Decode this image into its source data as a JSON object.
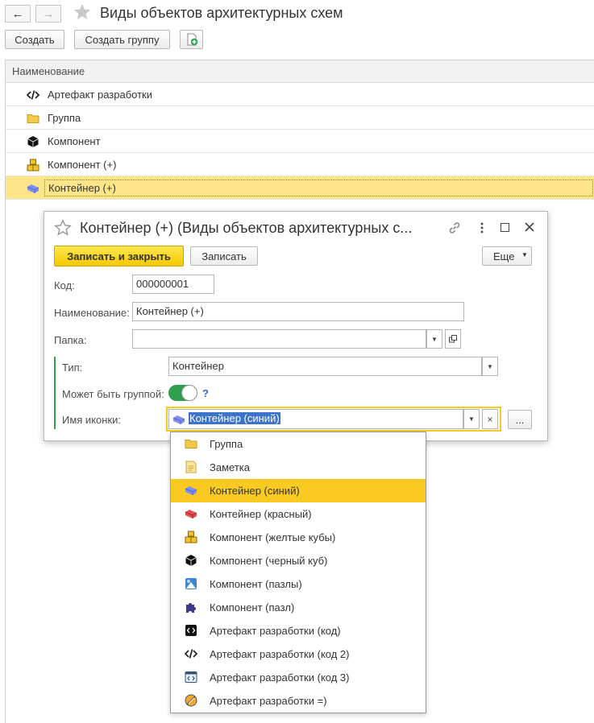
{
  "window": {
    "title": "Виды объектов архитектурных схем"
  },
  "toolbar": {
    "create_label": "Создать",
    "create_group_label": "Создать группу"
  },
  "list": {
    "column_header": "Наименование",
    "rows": [
      {
        "label": "Артефакт разработки",
        "icon": "code-icon"
      },
      {
        "label": "Группа",
        "icon": "folder-icon"
      },
      {
        "label": "Компонент",
        "icon": "black-cube-icon"
      },
      {
        "label": "Компонент (+)",
        "icon": "yellow-cubes-icon"
      },
      {
        "label": "Контейнер (+)",
        "icon": "blue-container-icon",
        "selected": true
      }
    ]
  },
  "dialog": {
    "title": "Контейнер (+) (Виды объектов архитектурных с...",
    "save_close_label": "Записать и закрыть",
    "save_label": "Записать",
    "more_label": "Еще",
    "code_label": "Код:",
    "code_value": "000000001",
    "name_label": "Наименование:",
    "name_value": "Контейнер (+)",
    "folder_label": "Папка:",
    "folder_value": "",
    "type_label": "Тип:",
    "type_value": "Контейнер",
    "can_be_group_label": "Может быть группой:",
    "can_be_group_value": true,
    "help_label": "?",
    "icon_name_label": "Имя иконки:",
    "icon_name_value": "Контейнер (синий)",
    "clear_label": "×",
    "ellipsis_label": "..."
  },
  "popup": {
    "items": [
      {
        "label": "Группа",
        "icon": "folder-icon"
      },
      {
        "label": "Заметка",
        "icon": "note-icon"
      },
      {
        "label": "Контейнер (синий)",
        "icon": "blue-container-icon",
        "selected": true
      },
      {
        "label": "Контейнер (красный)",
        "icon": "red-container-icon"
      },
      {
        "label": "Компонент (желтые кубы)",
        "icon": "yellow-cubes-icon"
      },
      {
        "label": "Компонент (черный куб)",
        "icon": "black-cube-icon"
      },
      {
        "label": "Компонент (пазлы)",
        "icon": "puzzles-icon"
      },
      {
        "label": "Компонент (пазл)",
        "icon": "puzzle-icon"
      },
      {
        "label": "Артефакт разработки (код)",
        "icon": "code-box-icon"
      },
      {
        "label": "Артефакт разработки (код 2)",
        "icon": "code-icon"
      },
      {
        "label": "Артефакт разработки (код 3)",
        "icon": "code-window-icon"
      },
      {
        "label": "Артефакт разработки =)",
        "icon": "artifact-icon"
      }
    ]
  },
  "colors": {
    "accent_yellow": "#f9cb22",
    "selection_row": "#fde689",
    "toggle_green": "#2e9e4f",
    "help_blue": "#2a6cc8"
  }
}
